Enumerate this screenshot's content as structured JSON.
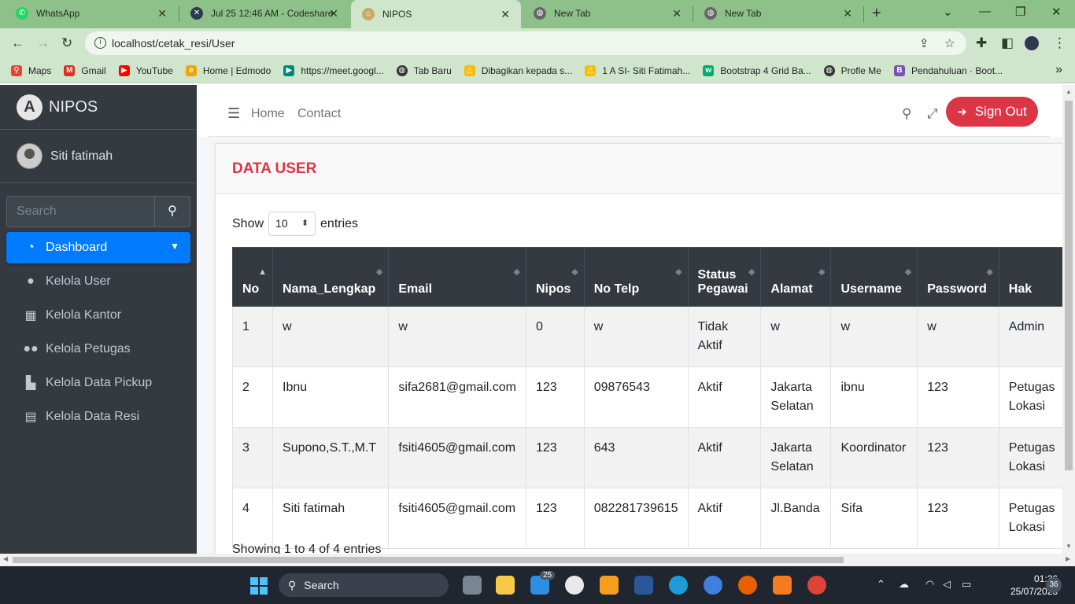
{
  "browser": {
    "tabs": [
      {
        "title": "WhatsApp",
        "icon": "whatsapp-icon",
        "color": "#25d366"
      },
      {
        "title": "Jul 25 12:46 AM - Codeshare",
        "icon": "codeshare-icon",
        "color": "#2b3a4e"
      },
      {
        "title": "NIPOS",
        "icon": "nipos-icon",
        "color": "#c8a96a"
      },
      {
        "title": "New Tab",
        "icon": "chrome-icon",
        "color": "#555"
      },
      {
        "title": "New Tab",
        "icon": "chrome-icon",
        "color": "#555"
      }
    ],
    "url": "localhost/cetak_resi/User",
    "bookmarks": [
      {
        "label": "Maps",
        "color": "#ea4335",
        "glyph": "⚲"
      },
      {
        "label": "Gmail",
        "color": "#d93025",
        "glyph": "M"
      },
      {
        "label": "YouTube",
        "color": "#ff0000",
        "glyph": "▶"
      },
      {
        "label": "Home | Edmodo",
        "color": "#f0a500",
        "glyph": "e"
      },
      {
        "label": "https://meet.googl...",
        "color": "#00897b",
        "glyph": "▶"
      },
      {
        "label": "Tab Baru",
        "color": "#333",
        "glyph": "◍"
      },
      {
        "label": "Dibagikan kepada s...",
        "color": "#fbbc04",
        "glyph": "△"
      },
      {
        "label": "1 A SI- Siti Fatimah...",
        "color": "#fbbc04",
        "glyph": "△"
      },
      {
        "label": "Bootstrap 4 Grid Ba...",
        "color": "#04aa6d",
        "glyph": "w"
      },
      {
        "label": "Profle Me",
        "color": "#333",
        "glyph": "◍"
      },
      {
        "label": "Pendahuluan · Boot...",
        "color": "#7952b3",
        "glyph": "B"
      }
    ]
  },
  "sidebar": {
    "brand": "NIPOS",
    "user": "Siti fatimah",
    "search_placeholder": "Search",
    "items": [
      {
        "label": "Dashboard",
        "icon": "tachometer-icon",
        "glyph": "◔"
      },
      {
        "label": "Kelola User",
        "icon": "user-icon",
        "glyph": "👤"
      },
      {
        "label": "Kelola Kantor",
        "icon": "building-icon",
        "glyph": "▦"
      },
      {
        "label": "Kelola Petugas",
        "icon": "users-icon",
        "glyph": "👥"
      },
      {
        "label": "Kelola Data Pickup",
        "icon": "boxes-icon",
        "glyph": "▙"
      },
      {
        "label": "Kelola Data Resi",
        "icon": "clipboard-icon",
        "glyph": "▤"
      }
    ]
  },
  "topnav": {
    "home": "Home",
    "contact": "Contact",
    "signout": "Sign Out"
  },
  "card": {
    "title": "DATA USER",
    "show": "Show",
    "entries_value": "10",
    "entries": "entries",
    "info": "Showing 1 to 4 of 4 entries"
  },
  "table": {
    "headers": [
      "No",
      "Nama_Lengkap",
      "Email",
      "Nipos",
      "No Telp",
      "Status Pegawai",
      "Alamat",
      "Username",
      "Password",
      "Hak"
    ],
    "rows": [
      [
        "1",
        "w",
        "w",
        "0",
        "w",
        "Tidak Aktif",
        "w",
        "w",
        "w",
        "Admin"
      ],
      [
        "2",
        "Ibnu",
        "sifa2681@gmail.com",
        "123",
        "09876543",
        "Aktif",
        "Jakarta Selatan",
        "ibnu",
        "123",
        "Petugas Lokasi"
      ],
      [
        "3",
        "Supono,S.T.,M.T",
        "fsiti4605@gmail.com",
        "123",
        "643",
        "Aktif",
        "Jakarta Selatan",
        "Koordinator",
        "123",
        "Petugas Lokasi"
      ],
      [
        "4",
        "Siti fatimah",
        "fsiti4605@gmail.com",
        "123",
        "082281739615",
        "Aktif",
        "Jl.Banda",
        "Sifa",
        "123",
        "Petugas Lokasi"
      ]
    ]
  },
  "taskbar": {
    "search": "Search",
    "mail_badge": "25",
    "time": "01:36",
    "date": "25/07/2023",
    "notifications": "36"
  }
}
